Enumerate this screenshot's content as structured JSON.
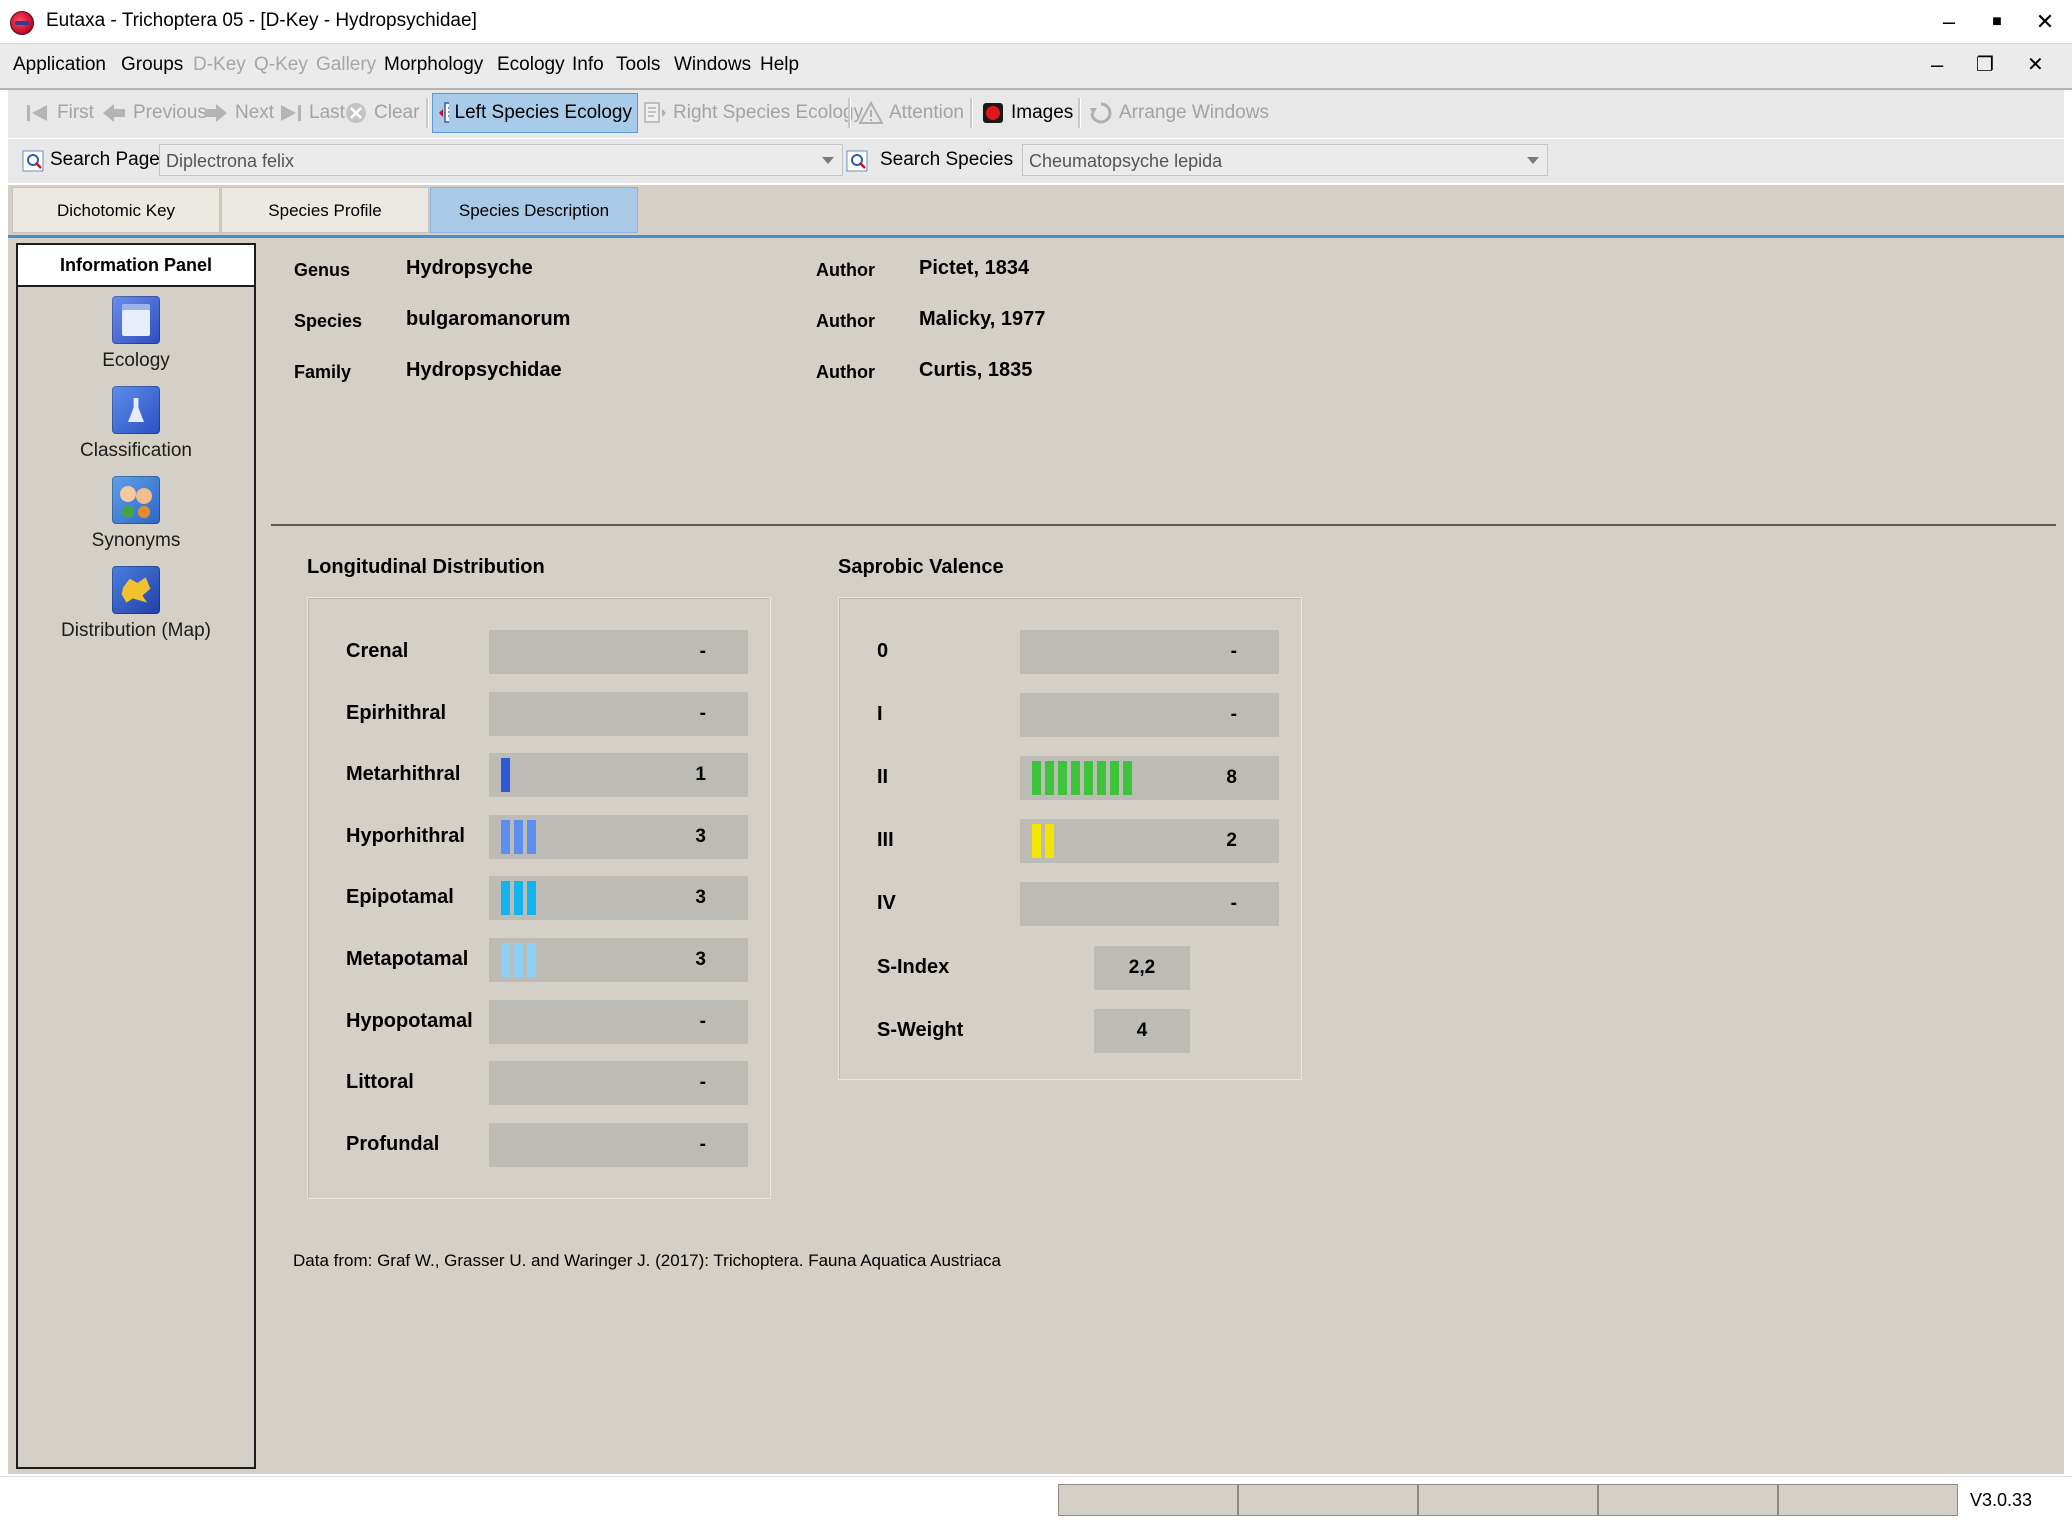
{
  "window": {
    "title": "Eutaxa - Trichoptera 05 - [D-Key - Hydropsychidae]",
    "controls": {
      "minimize": "–",
      "maximize": "■",
      "close": "✕"
    },
    "mdi_controls": {
      "minimize": "–",
      "restore": "❐",
      "close": "✕"
    }
  },
  "menubar": [
    {
      "label": "Application",
      "enabled": true
    },
    {
      "label": "Groups",
      "enabled": true
    },
    {
      "label": "D-Key",
      "enabled": false
    },
    {
      "label": "Q-Key",
      "enabled": false
    },
    {
      "label": "Gallery",
      "enabled": false
    },
    {
      "label": "Morphology",
      "enabled": true
    },
    {
      "label": "Ecology",
      "enabled": true
    },
    {
      "label": "Info",
      "enabled": true
    },
    {
      "label": "Tools",
      "enabled": true
    },
    {
      "label": "Windows",
      "enabled": true
    },
    {
      "label": "Help",
      "enabled": true
    }
  ],
  "toolbar": {
    "first": "First",
    "previous": "Previous",
    "next": "Next",
    "last": "Last",
    "clear": "Clear",
    "left_species_ecology": "Left Species Ecology",
    "right_species_ecology": "Right Species Ecology",
    "attention": "Attention",
    "images": "Images",
    "arrange_windows": "Arrange Windows"
  },
  "search": {
    "page_label": "Search Page",
    "page_value": "Diplectrona felix",
    "species_label": "Search Species",
    "species_value": "Cheumatopsyche lepida"
  },
  "tabs": [
    {
      "label": "Dichotomic Key",
      "selected": false
    },
    {
      "label": "Species Profile",
      "selected": false
    },
    {
      "label": "Species Description",
      "selected": true
    }
  ],
  "info_panel": {
    "header": "Information Panel",
    "items": [
      {
        "label": "Ecology",
        "icon": "ecology-icon"
      },
      {
        "label": "Classification",
        "icon": "classification-icon"
      },
      {
        "label": "Synonyms",
        "icon": "synonyms-icon"
      },
      {
        "label": "Distribution (Map)",
        "icon": "distribution-map-icon"
      }
    ]
  },
  "taxon": {
    "genus_label": "Genus",
    "genus": "Hydropsyche",
    "genus_author_label": "Author",
    "genus_author": "Pictet, 1834",
    "species_label": "Species",
    "species": "bulgaromanorum",
    "species_author_label": "Author",
    "species_author": "Malicky, 1977",
    "family_label": "Family",
    "family": "Hydropsychidae",
    "family_author_label": "Author",
    "family_author": "Curtis, 1835"
  },
  "longitudinal": {
    "title": "Longitudinal Distribution",
    "rows": [
      {
        "label": "Crenal",
        "value": "-",
        "count": 0,
        "color": "#2b5fe0"
      },
      {
        "label": "Epirhithral",
        "value": "-",
        "count": 0,
        "color": "#2b5fe0"
      },
      {
        "label": "Metarhithral",
        "value": "1",
        "count": 1,
        "color": "#2e5ad8"
      },
      {
        "label": "Hyporhithral",
        "value": "3",
        "count": 3,
        "color": "#5b8ff0"
      },
      {
        "label": "Epipotamal",
        "value": "3",
        "count": 3,
        "color": "#12b4f0"
      },
      {
        "label": "Metapotamal",
        "value": "3",
        "count": 3,
        "color": "#8ed0f5"
      },
      {
        "label": "Hypopotamal",
        "value": "-",
        "count": 0,
        "color": "#8ed0f5"
      },
      {
        "label": "Littoral",
        "value": "-",
        "count": 0,
        "color": "#8ed0f5"
      },
      {
        "label": "Profundal",
        "value": "-",
        "count": 0,
        "color": "#8ed0f5"
      }
    ]
  },
  "saprobic": {
    "title": "Saprobic Valence",
    "rows": [
      {
        "label": "0",
        "value": "-",
        "count": 0,
        "color": "#3ec43a"
      },
      {
        "label": "I",
        "value": "-",
        "count": 0,
        "color": "#3ec43a"
      },
      {
        "label": "II",
        "value": "8",
        "count": 8,
        "color": "#3ec43a"
      },
      {
        "label": "III",
        "value": "2",
        "count": 2,
        "color": "#f2e600"
      },
      {
        "label": "IV",
        "value": "-",
        "count": 0,
        "color": "#f2e600"
      }
    ],
    "s_index_label": "S-Index",
    "s_index": "2,2",
    "s_weight_label": "S-Weight",
    "s_weight": "4"
  },
  "data_source": "Data from: Graf W., Grasser U. and Waringer J. (2017): Trichoptera. Fauna Aquatica Austriaca",
  "status": {
    "version": "V3.0.33"
  }
}
